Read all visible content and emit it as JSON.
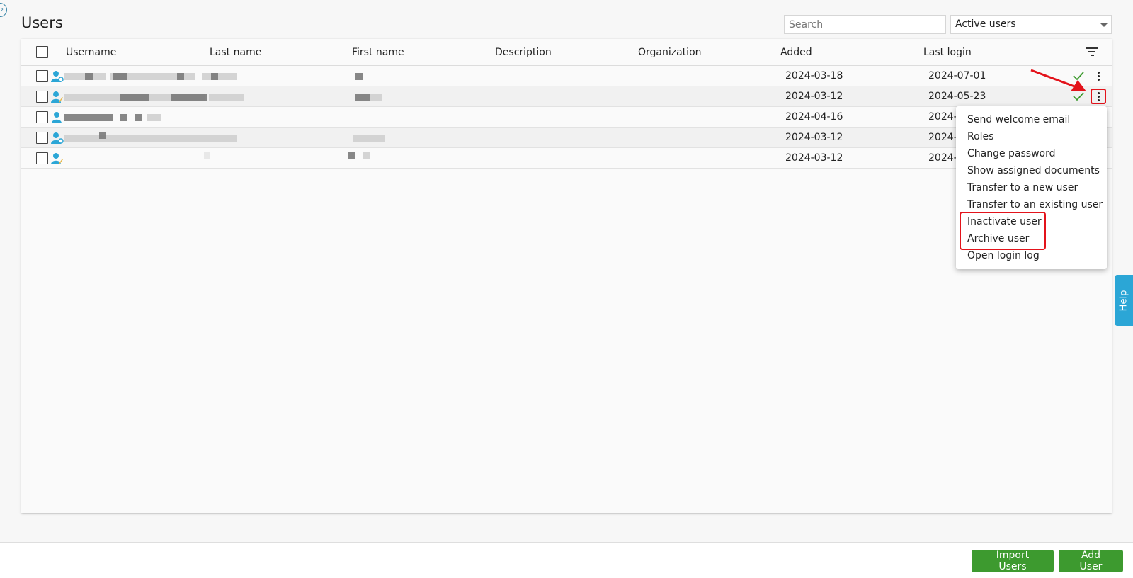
{
  "page": {
    "title": "Users"
  },
  "search": {
    "placeholder": "Search"
  },
  "status_filter": {
    "selected": "Active users"
  },
  "columns": [
    "Username",
    "Last name",
    "First name",
    "Description",
    "Organization",
    "Added",
    "Last login"
  ],
  "rows": [
    {
      "added": "2024-03-18",
      "last_login": "2024-07-01"
    },
    {
      "added": "2024-03-12",
      "last_login": "2024-05-23"
    },
    {
      "added": "2024-04-16",
      "last_login": "2024-"
    },
    {
      "added": "2024-03-12",
      "last_login": "2024-"
    },
    {
      "added": "2024-03-12",
      "last_login": "2024-"
    }
  ],
  "context_menu": {
    "items": [
      "Send welcome email",
      "Roles",
      "Change password",
      "Show assigned documents",
      "Transfer to a new user",
      "Transfer to an existing user",
      "Inactivate user",
      "Archive user",
      "Open login log"
    ]
  },
  "help": {
    "label": "Help"
  },
  "footer": {
    "import_label": "Import Users",
    "add_label": "Add User"
  },
  "colors": {
    "accent_green": "#3d9a2f",
    "highlight_red": "#e3131b",
    "help_blue": "#2ba6d6",
    "check_green": "#3d9a2f",
    "user_icon_blue": "#2ba6d6"
  }
}
